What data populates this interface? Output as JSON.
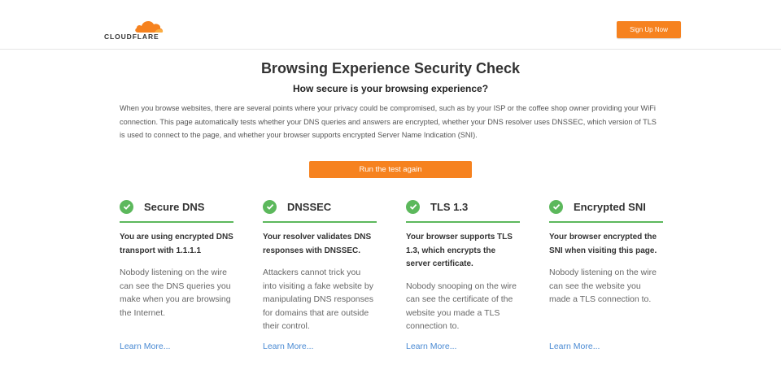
{
  "header": {
    "logo_text": "CLOUDFLARE",
    "signup_label": "Sign Up Now"
  },
  "main": {
    "title": "Browsing Experience Security Check",
    "subtitle": "How secure is your browsing experience?",
    "intro": "When you browse websites, there are several points where your privacy could be compromised, such as by your ISP or the coffee shop owner providing your WiFi connection. This page automatically tests whether your DNS queries and answers are encrypted, whether your DNS resolver uses DNSSEC, which version of TLS is used to connect to the page, and whether your browser supports encrypted Server Name Indication (SNI).",
    "run_button": "Run the test again"
  },
  "cards": [
    {
      "title": "Secure DNS",
      "bold": "You are using encrypted DNS transport with 1.1.1.1",
      "body": "Nobody listening on the wire can see the DNS queries you make when you are browsing the Internet.",
      "link": "Learn More..."
    },
    {
      "title": "DNSSEC",
      "bold": "Your resolver validates DNS responses with DNSSEC.",
      "body": "Attackers cannot trick you into visiting a fake website by manipulating DNS responses for domains that are outside their control.",
      "link": "Learn More..."
    },
    {
      "title": "TLS 1.3",
      "bold": "Your browser supports TLS 1.3, which encrypts the server certificate.",
      "body": "Nobody snooping on the wire can see the certificate of the website you made a TLS connection to.",
      "link": "Learn More..."
    },
    {
      "title": "Encrypted SNI",
      "bold": "Your browser encrypted the SNI when visiting this page.",
      "body": "Nobody listening on the wire can see the website you made a TLS connection to.",
      "link": "Learn More..."
    }
  ],
  "colors": {
    "accent": "#f6821f",
    "success": "#5cb85c",
    "link": "#4a8ad3"
  },
  "icons": {
    "logo": "cloudflare-cloud-icon",
    "status": "check-circle-icon"
  }
}
